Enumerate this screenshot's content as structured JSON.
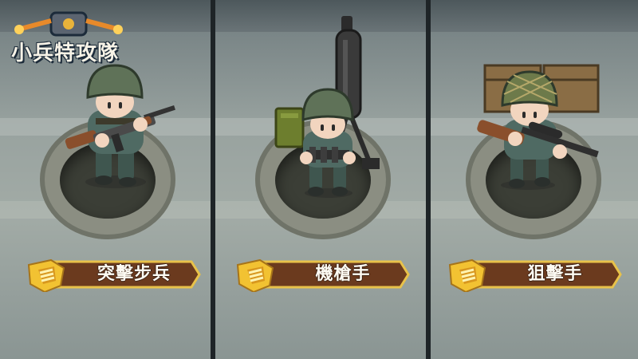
{
  "logo": {
    "title": "小兵特攻隊"
  },
  "classes": [
    {
      "label": "突擊步兵",
      "weapon": "assault-rifle"
    },
    {
      "label": "機槍手",
      "weapon": "machine-gun"
    },
    {
      "label": "狙擊手",
      "weapon": "sniper-rifle"
    }
  ],
  "colors": {
    "banner_fill": "#6b3a1e",
    "banner_border": "#e8c24a",
    "badge_gold": "#f2c232",
    "helmet_green": "#5f7258",
    "uniform_green": "#4f6a63"
  }
}
